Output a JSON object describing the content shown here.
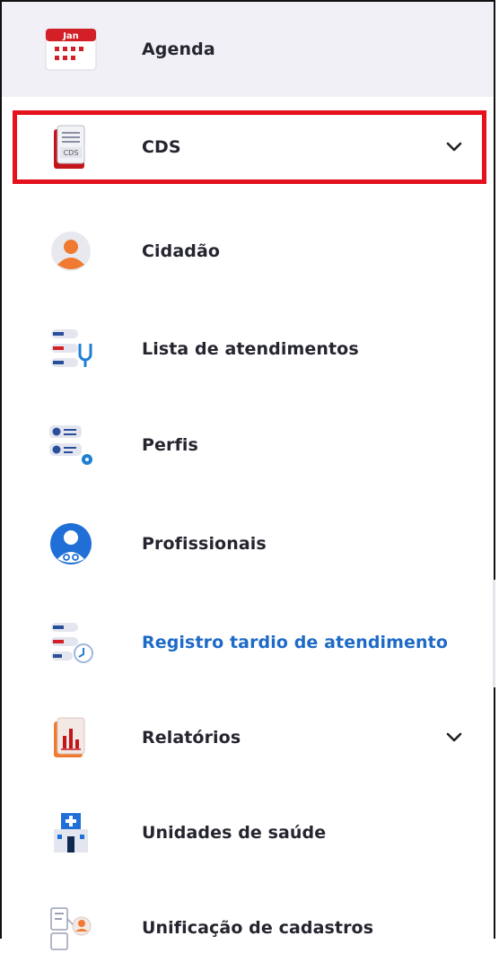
{
  "menu": {
    "items": [
      {
        "label": "Agenda",
        "icon": "calendar-icon",
        "badge": "Jan"
      },
      {
        "label": "CDS",
        "icon": "cds-document-icon",
        "badge": "CDS",
        "expandable": true
      },
      {
        "label": "Cidadão",
        "icon": "citizen-avatar-icon"
      },
      {
        "label": "Lista de atendimentos",
        "icon": "attendance-list-icon"
      },
      {
        "label": "Perfis",
        "icon": "profiles-settings-icon"
      },
      {
        "label": "Profissionais",
        "icon": "professional-doctor-icon"
      },
      {
        "label": "Registro tardio de atendimento",
        "icon": "late-record-clock-icon",
        "active": true
      },
      {
        "label": "Relatórios",
        "icon": "reports-chart-icon",
        "expandable": true
      },
      {
        "label": "Unidades de saúde",
        "icon": "health-unit-icon"
      },
      {
        "label": "Unificação de cadastros",
        "icon": "merge-records-icon"
      }
    ]
  },
  "colors": {
    "highlight_border": "#e3121d",
    "active_text": "#1e6ac7",
    "text": "#24252e",
    "hover_bg": "#f0f0f6"
  }
}
